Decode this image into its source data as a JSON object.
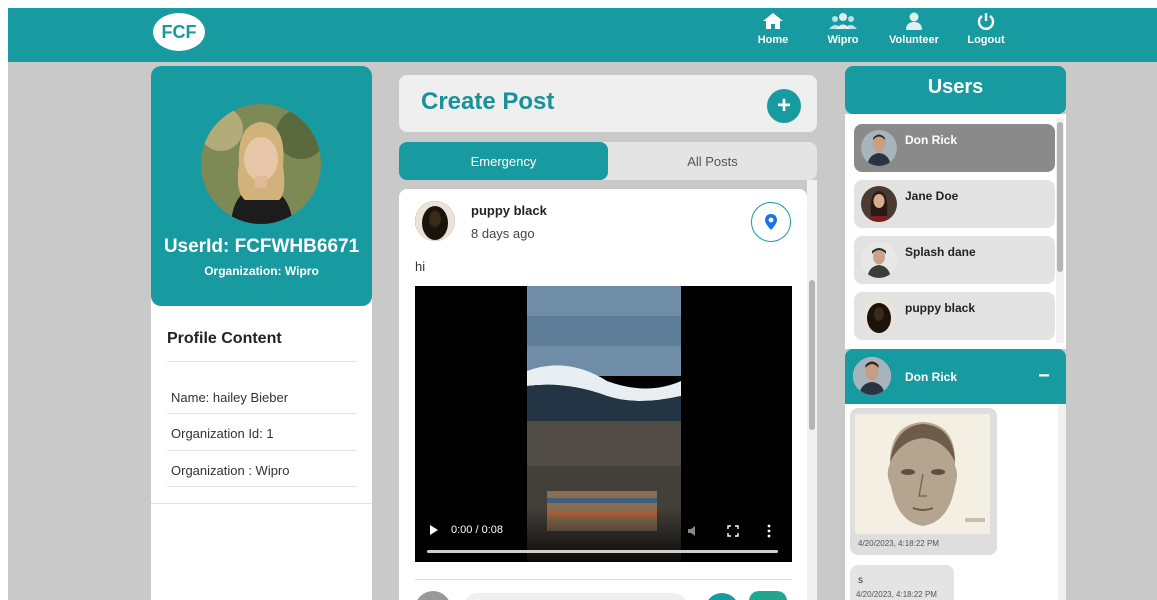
{
  "header": {
    "logo": "FCF",
    "nav": [
      {
        "label": "Home",
        "icon": "home-icon"
      },
      {
        "label": "Wipro",
        "icon": "group-icon"
      },
      {
        "label": "Volunteer",
        "icon": "user-icon"
      },
      {
        "label": "Logout",
        "icon": "power-icon"
      }
    ]
  },
  "profile": {
    "user_id": "UserId: FCFWHB6671",
    "organization": "Organization: Wipro",
    "content_title": "Profile Content",
    "items": [
      "Name: hailey Bieber",
      "Organization Id: 1",
      "Organization : Wipro"
    ]
  },
  "create_post": {
    "title": "Create Post",
    "add_label": "+"
  },
  "tabs": [
    {
      "label": "Emergency",
      "active": true
    },
    {
      "label": "All Posts",
      "active": false
    }
  ],
  "post": {
    "author": "puppy black",
    "time": "8 days ago",
    "text": "hi",
    "video": {
      "time": "0:00 / 0:08",
      "progress": 0
    }
  },
  "users": {
    "title": "Users",
    "items": [
      {
        "name": "Don Rick",
        "selected": true
      },
      {
        "name": "Jane Doe",
        "selected": false
      },
      {
        "name": "Splash dane",
        "selected": false
      },
      {
        "name": "puppy black",
        "selected": false
      }
    ]
  },
  "chat": {
    "name": "Don Rick",
    "minimize": "−",
    "messages": [
      {
        "type": "image",
        "time": "4/20/2023, 4:18:22 PM"
      },
      {
        "type": "text",
        "text": "s",
        "time": "4/20/2023, 4:18:22 PM"
      }
    ]
  },
  "colors": {
    "accent": "#189aa1",
    "background": "#c9c9c9"
  }
}
